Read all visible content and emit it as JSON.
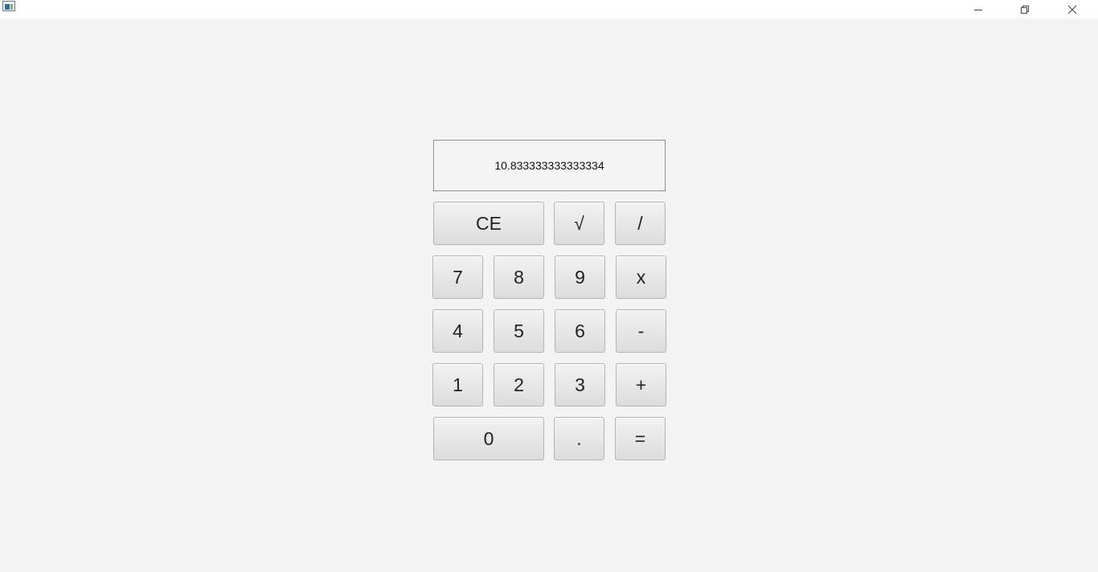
{
  "window": {
    "controls": {
      "minimize_icon": "minimize-icon",
      "maximize_icon": "restore-icon",
      "close_icon": "close-icon"
    }
  },
  "display": {
    "value": "10.833333333333334"
  },
  "keys": {
    "ce": "CE",
    "sqrt": "√",
    "divide": "/",
    "seven": "7",
    "eight": "8",
    "nine": "9",
    "multiply": "x",
    "four": "4",
    "five": "5",
    "six": "6",
    "minus": "-",
    "one": "1",
    "two": "2",
    "three": "3",
    "plus": "+",
    "zero": "0",
    "dot": ".",
    "equals": "="
  },
  "colors": {
    "background": "#f3f3f3",
    "titlebar": "#ffffff",
    "key_text": "#222222"
  }
}
